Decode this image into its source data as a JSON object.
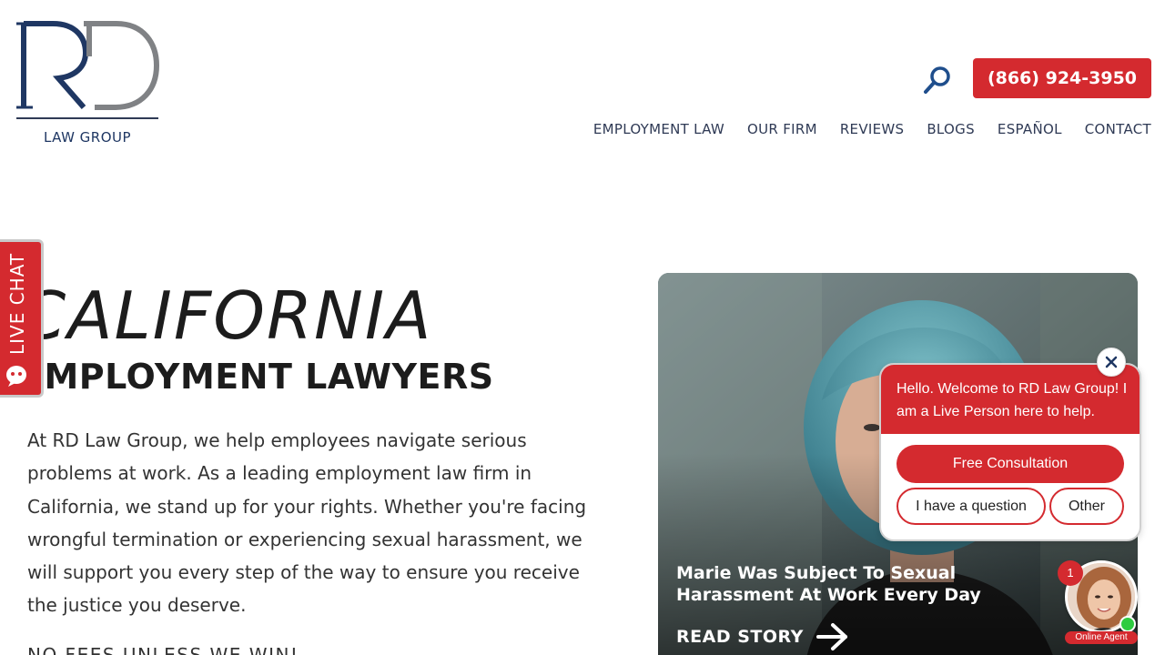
{
  "header": {
    "logo": {
      "letters": "RD",
      "subtitle": "LAW GROUP"
    },
    "phone_label": "(866) 924-3950",
    "search_icon": "search-icon",
    "nav": [
      {
        "label": "EMPLOYMENT LAW"
      },
      {
        "label": "OUR FIRM"
      },
      {
        "label": "REVIEWS"
      },
      {
        "label": "BLOGS"
      },
      {
        "label": "ESPAÑOL"
      },
      {
        "label": "CONTACT"
      }
    ]
  },
  "live_chat_tab": {
    "label": "LIVE CHAT",
    "icon": "chat-bubble-icon"
  },
  "hero": {
    "title_line1": "CALIFORNIA",
    "title_line2": "EMPLOYMENT LAWYERS",
    "paragraph": "At RD Law Group, we help employees navigate serious problems at work. As a leading employment law firm in California, we stand up for your rights. Whether you're facing wrongful termination or experiencing sexual harassment, we will support you every step of the way to ensure you receive the justice you deserve.",
    "tagline": "NO FEES UNLESS WE WIN!"
  },
  "story_card": {
    "title": "Marie Was Subject To Sexual Harassment At Work Every Day",
    "cta_label": "READ STORY",
    "cta_icon": "arrow-right-icon"
  },
  "chat_widget": {
    "message": "Hello. Welcome to RD Law Group! I am a Live Person here to help.",
    "primary_button": "Free Consultation",
    "secondary_button_1": "I have a question",
    "secondary_button_2": "Other",
    "close_icon": "close-icon",
    "badge_count": "1",
    "agent_label": "Online Agent"
  },
  "colors": {
    "brand_red": "#d42a2f",
    "brand_navy": "#1f3763",
    "text_dark": "#1c1c1c",
    "online_green": "#2ecc40"
  }
}
